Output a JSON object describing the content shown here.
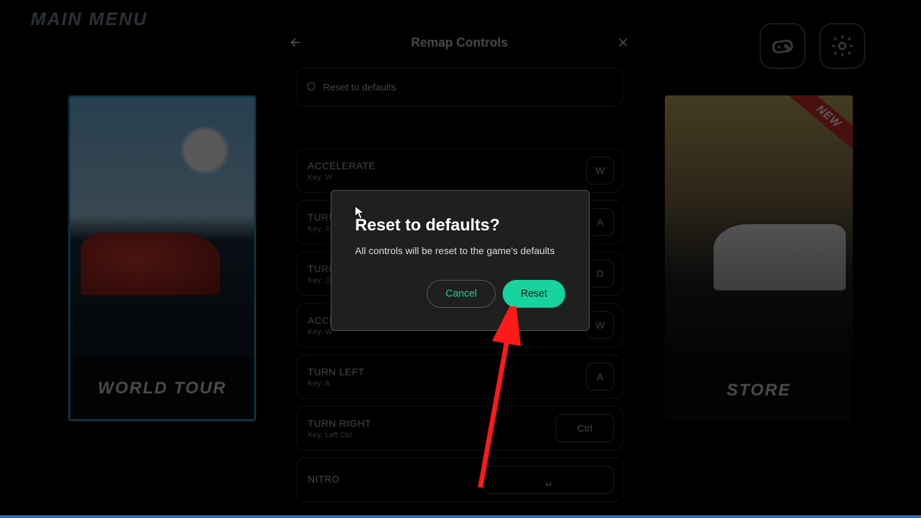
{
  "menu": {
    "title": "MAIN MENU",
    "cards": {
      "left_label": "WORLD TOUR",
      "right_label": "STORE",
      "new_badge": "NEW"
    }
  },
  "remap": {
    "title": "Remap Controls",
    "reset_row": "Reset to defaults",
    "controls": [
      {
        "name": "ACCELERATE",
        "key_label": "Key: W",
        "badge": "W"
      },
      {
        "name": "TURN LEFT",
        "key_label": "Key: A",
        "badge": "A"
      },
      {
        "name": "TURN RIGHT",
        "key_label": "Key: D",
        "badge": "D"
      },
      {
        "name": "ACCELERATE",
        "key_label": "Key: W",
        "badge": "W"
      },
      {
        "name": "TURN LEFT",
        "key_label": "Key: A",
        "badge": "A"
      },
      {
        "name": "TURN RIGHT",
        "key_label": "Key: Left Ctrl",
        "badge": "Ctrl"
      },
      {
        "name": "NITRO",
        "key_label": "",
        "badge": "␣"
      }
    ]
  },
  "dialog": {
    "title": "Reset to defaults?",
    "text": "All controls will be reset to the game's defaults",
    "cancel": "Cancel",
    "confirm": "Reset"
  }
}
